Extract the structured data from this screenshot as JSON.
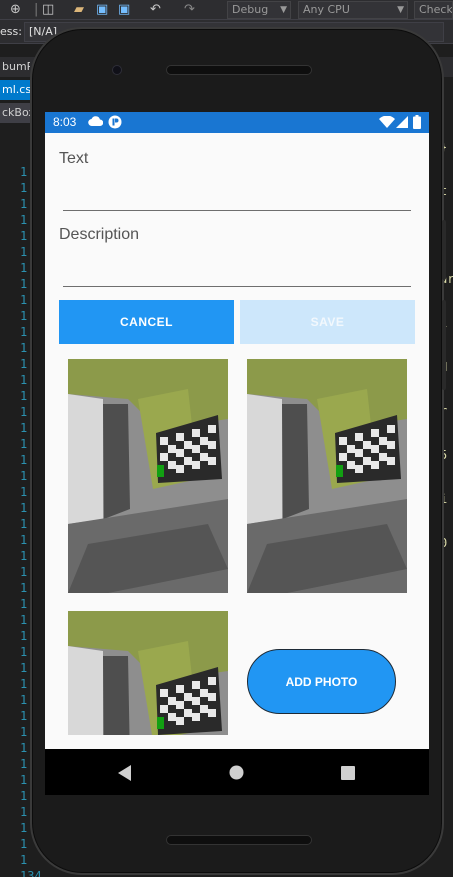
{
  "ide": {
    "config_combo": "Debug",
    "platform_combo": "Any CPU",
    "startup_combo": "CheckBox",
    "process_label": "ess:",
    "process_value": "[N/A]",
    "tabs": [
      "bumP",
      "ml.cs",
      "ckBox"
    ],
    "line_numbers": [
      "1",
      "1",
      "1",
      "1",
      "1",
      "1",
      "1",
      "1",
      "1",
      "1",
      "1",
      "1",
      "1",
      "1",
      "1",
      "1",
      "1",
      "1",
      "1",
      "1",
      "1",
      "1",
      "1",
      "1",
      "1",
      "1",
      "1",
      "1",
      "1",
      "1",
      "1",
      "1",
      "1",
      "1",
      "1",
      "1",
      "1",
      "1",
      "1",
      "1",
      "1",
      "1",
      "1",
      "1",
      "134",
      "134"
    ],
    "code_fragments": [
      "}",
      "t",
      "",
      "ar",
      "i",
      "N",
      "r",
      "5",
      "i",
      "0"
    ]
  },
  "status_bar": {
    "time": "8:03"
  },
  "form": {
    "text_label": "Text",
    "text_value": "",
    "description_label": "Description",
    "description_value": ""
  },
  "buttons": {
    "cancel_label": "CANCEL",
    "save_label": "SAVE",
    "add_photo_label": "ADD PHOTO"
  },
  "colors": {
    "accent": "#2196f3",
    "status_bar": "#1976d2",
    "save_disabled": "#cde7fb",
    "nav_bar": "#000000"
  },
  "photos": [
    {
      "icon": "room-photo"
    },
    {
      "icon": "room-photo"
    },
    {
      "icon": "room-photo"
    }
  ]
}
